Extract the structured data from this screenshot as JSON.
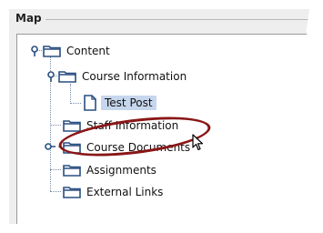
{
  "panel": {
    "title": "Map"
  },
  "tree": {
    "items": [
      {
        "label": "Content",
        "icon": "folder-icon",
        "expanded": true
      },
      {
        "label": "Course Information",
        "icon": "folder-icon",
        "expanded": true
      },
      {
        "label": "Test Post",
        "icon": "page-icon",
        "selected": true
      },
      {
        "label": "Staff Information",
        "icon": "folder-icon"
      },
      {
        "label": "Course Documents",
        "icon": "folder-icon",
        "expanded": false
      },
      {
        "label": "Assignments",
        "icon": "folder-icon"
      },
      {
        "label": "External Links",
        "icon": "folder-icon"
      }
    ]
  },
  "annotation": {
    "color": "#8a1616",
    "shape": "ellipse"
  },
  "colors": {
    "selection": "#c6d6ec",
    "folder": "#2a4f80",
    "tree_line": "#7a8da8"
  }
}
